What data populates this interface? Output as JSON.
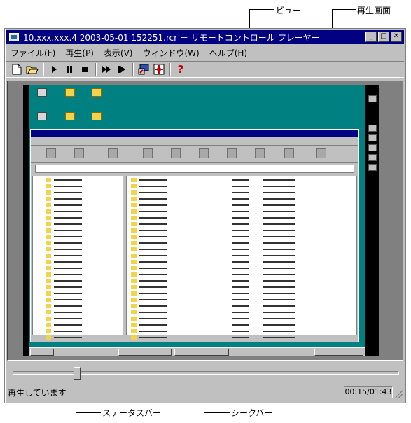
{
  "callouts": {
    "view": "ビュー",
    "playback_screen": "再生画面",
    "status_bar": "ステータスバー",
    "seek_bar": "シークバー"
  },
  "window": {
    "title": "10.xxx.xxx.4 2003-05-01 152251.rcr － リモートコントロール プレーヤー",
    "controls": {
      "minimize": "_",
      "maximize": "□",
      "close": "✕"
    }
  },
  "menu": [
    {
      "label": "ファイル(F)"
    },
    {
      "label": "再生(P)"
    },
    {
      "label": "表示(V)"
    },
    {
      "label": "ウィンドウ(W)"
    },
    {
      "label": "ヘルプ(H)"
    }
  ],
  "toolbar": {
    "buttons": [
      {
        "icon": "new-document-icon"
      },
      {
        "icon": "open-folder-icon"
      },
      {
        "icon": "play-icon"
      },
      {
        "icon": "pause-icon"
      },
      {
        "icon": "stop-icon"
      },
      {
        "icon": "fast-forward-icon"
      },
      {
        "icon": "step-forward-icon"
      },
      {
        "icon": "screen-settings-icon"
      },
      {
        "icon": "zoom-icon"
      },
      {
        "icon": "help-icon",
        "label": "?"
      }
    ]
  },
  "seek": {
    "position_fraction": 0.16
  },
  "status": {
    "text": "再生しています",
    "time": "00:15/01:43"
  }
}
